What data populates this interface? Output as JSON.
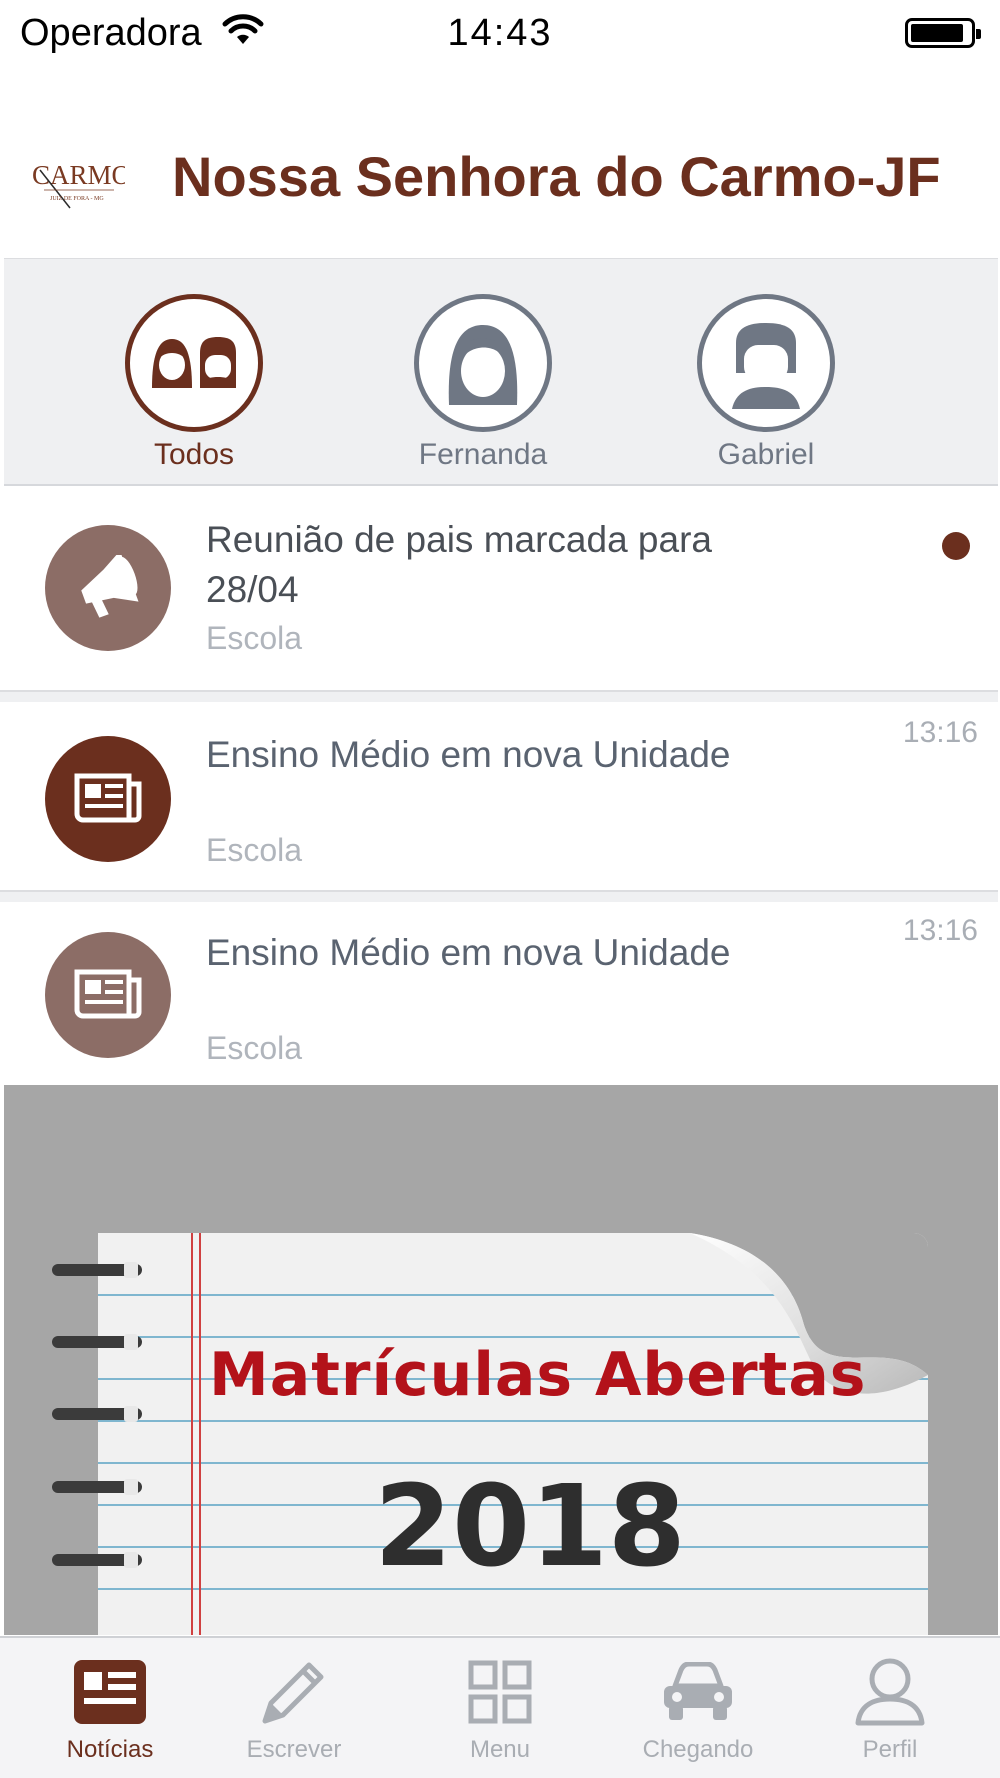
{
  "status_bar": {
    "carrier": "Operadora",
    "time": "14:43"
  },
  "header": {
    "title": "Nossa Senhora do Carmo-JF",
    "logo_text": "CARMO"
  },
  "children": [
    {
      "name": "Todos",
      "active": true
    },
    {
      "name": "Fernanda",
      "active": false
    },
    {
      "name": "Gabriel",
      "active": false
    }
  ],
  "news": [
    {
      "title": "Reunião de pais marcada para 28/04",
      "source": "Escola",
      "time": "",
      "unread": true,
      "icon": "megaphone-icon"
    },
    {
      "title": "Ensino Médio em nova Unidade",
      "source": "Escola",
      "time": "13:16",
      "unread": false,
      "icon": "newspaper-icon"
    },
    {
      "title": "Ensino Médio em nova Unidade",
      "source": "Escola",
      "time": "13:16",
      "unread": false,
      "icon": "newspaper-icon"
    }
  ],
  "banner": {
    "headline": "Matrículas Abertas",
    "year": "2018"
  },
  "tabs": [
    {
      "label": "Notícias",
      "icon": "news-icon",
      "active": true
    },
    {
      "label": "Escrever",
      "icon": "pencil-icon",
      "active": false
    },
    {
      "label": "Menu",
      "icon": "grid-icon",
      "active": false
    },
    {
      "label": "Chegando",
      "icon": "car-icon",
      "active": false
    },
    {
      "label": "Perfil",
      "icon": "person-icon",
      "active": false
    }
  ],
  "colors": {
    "brand": "#6b2f1e",
    "brand_muted": "#8c6d66",
    "inactive": "#a9adb3",
    "banner_text": "#b3121a"
  }
}
